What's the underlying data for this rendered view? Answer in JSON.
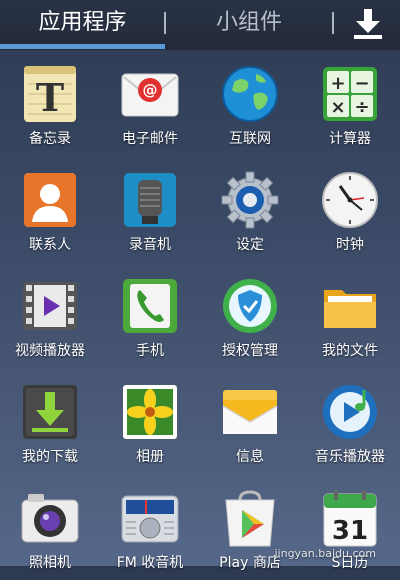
{
  "tabs": {
    "apps": "应用程序",
    "widgets": "小组件"
  },
  "apps": [
    {
      "label": "备忘录",
      "icon": "memo-icon"
    },
    {
      "label": "电子邮件",
      "icon": "email-icon"
    },
    {
      "label": "互联网",
      "icon": "globe-icon"
    },
    {
      "label": "计算器",
      "icon": "calculator-icon"
    },
    {
      "label": "联系人",
      "icon": "contacts-icon"
    },
    {
      "label": "录音机",
      "icon": "microphone-icon"
    },
    {
      "label": "设定",
      "icon": "gear-icon"
    },
    {
      "label": "时钟",
      "icon": "clock-icon"
    },
    {
      "label": "视频播放器",
      "icon": "video-player-icon"
    },
    {
      "label": "手机",
      "icon": "phone-icon"
    },
    {
      "label": "授权管理",
      "icon": "shield-icon"
    },
    {
      "label": "我的文件",
      "icon": "folder-icon"
    },
    {
      "label": "我的下载",
      "icon": "download-icon"
    },
    {
      "label": "相册",
      "icon": "gallery-icon"
    },
    {
      "label": "信息",
      "icon": "message-icon"
    },
    {
      "label": "音乐播放器",
      "icon": "music-player-icon"
    },
    {
      "label": "照相机",
      "icon": "camera-icon"
    },
    {
      "label": "FM 收音机",
      "icon": "radio-icon"
    },
    {
      "label": "Play 商店",
      "icon": "play-store-icon"
    },
    {
      "label": "S日历",
      "icon": "calendar-icon"
    }
  ],
  "calendar_day": "31",
  "watermark": "jingyan.baidu.com"
}
